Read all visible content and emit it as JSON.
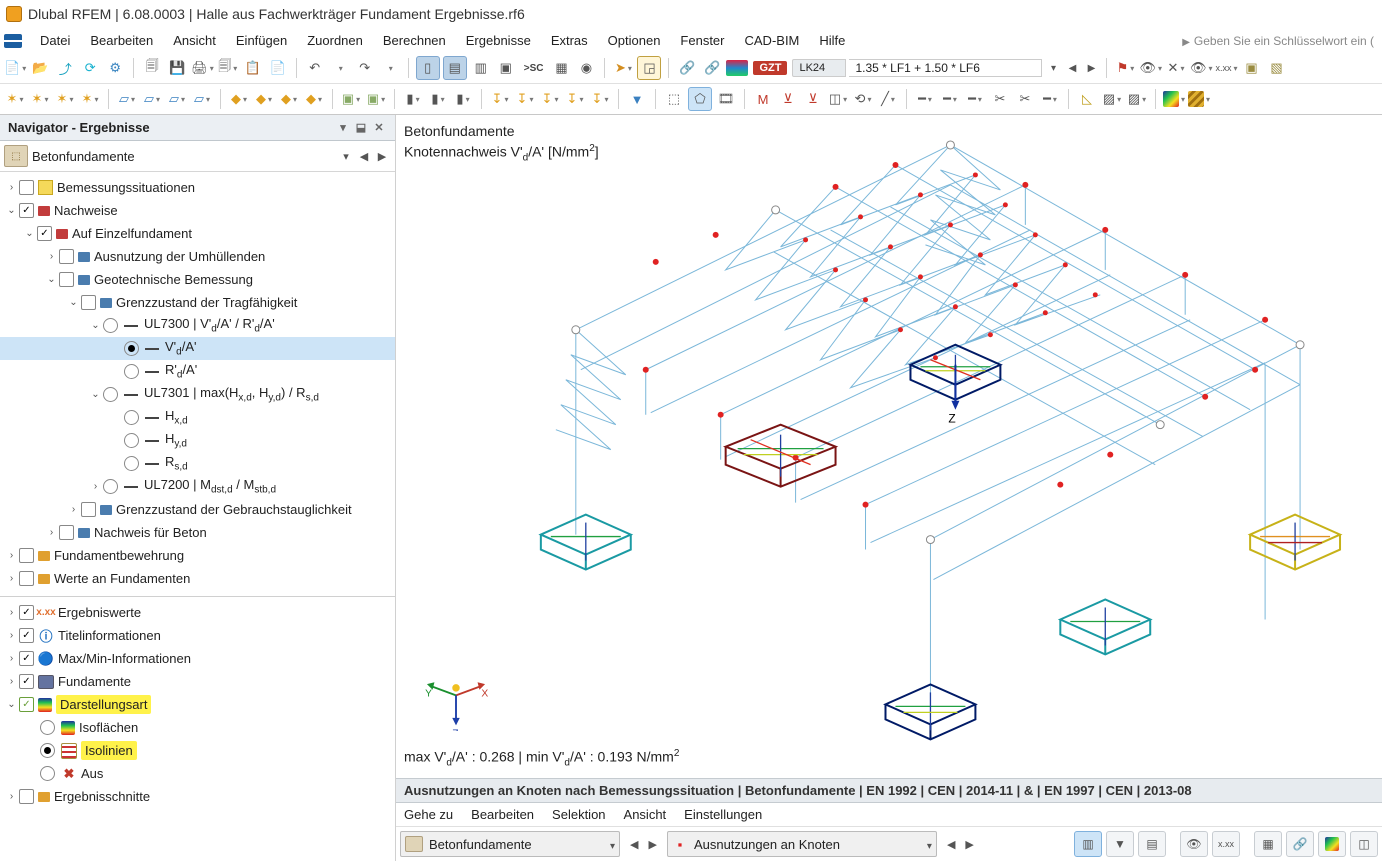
{
  "title": "Dlubal RFEM | 6.08.0003 | Halle aus Fachwerkträger Fundament Ergebnisse.rf6",
  "menu": {
    "items": [
      "Datei",
      "Bearbeiten",
      "Ansicht",
      "Einfügen",
      "Zuordnen",
      "Berechnen",
      "Ergebnisse",
      "Extras",
      "Optionen",
      "Fenster",
      "CAD-BIM",
      "Hilfe"
    ],
    "keyhint": "Geben Sie ein Schlüsselwort ein ("
  },
  "combo": {
    "gzt": "GZT",
    "lk_label": "LK24",
    "lk_desc": "1.35 * LF1 + 1.50 * LF6"
  },
  "navigator": {
    "title": "Navigator - Ergebnisse",
    "selector": "Betonfundamente",
    "tree": {
      "bem_sit": "Bemessungssituationen",
      "nachweise": "Nachweise",
      "auf_einzel": "Auf Einzelfundament",
      "ausnutz": "Ausnutzung der Umhüllenden",
      "geotech": "Geotechnische Bemessung",
      "gzt_trag": "Grenzzustand der Tragfähigkeit",
      "ul7300": "UL7300 | V'd/A' / R'd/A'",
      "vda": "V'd/A'",
      "rda": "R'd/A'",
      "ul7301": "UL7301 | max(Hx,d, Hy,d) / Rs,d",
      "hxd": "Hx,d",
      "hyd": "Hy,d",
      "rsd": "Rs,d",
      "ul7200": "UL7200 | Mdst,d / Mstb,d",
      "gebrauch": "Grenzzustand der Gebrauchstauglichkeit",
      "nachweis_beton": "Nachweis für Beton",
      "fund_bew": "Fundamentbewehrung",
      "werte_fund": "Werte an Fundamenten",
      "erg_werte": "Ergebniswerte",
      "titel_info": "Titelinformationen",
      "maxmin": "Max/Min-Informationen",
      "fundamente": "Fundamente",
      "darst": "Darstellungsart",
      "iso_fl": "Isoflächen",
      "iso_ln": "Isolinien",
      "aus": "Aus",
      "erg_schnitte": "Ergebnisschnitte"
    }
  },
  "viewport": {
    "title1": "Betonfundamente",
    "title2_pre": "Knotennachweis V'",
    "title2_sub1": "d",
    "title2_mid": "/A' [N/mm",
    "title2_sup": "2",
    "title2_end": "]",
    "stat_max_lbl": "max V'",
    "stat_sub": "d",
    "stat_max_val": "/A' : 0.268",
    "stat_sep": " | ",
    "stat_min_lbl": "min V'",
    "stat_min_val": "/A' : 0.193 N/mm",
    "axis_x": "X",
    "axis_y": "Y",
    "axis_z": "Z"
  },
  "results": {
    "header": "Ausnutzungen an Knoten nach Bemessungssituation | Betonfundamente | EN 1992 | CEN | 2014-11 | & | EN 1997 | CEN | 2013-08",
    "menu": [
      "Gehe zu",
      "Bearbeiten",
      "Selektion",
      "Ansicht",
      "Einstellungen"
    ],
    "combo1": "Betonfundamente",
    "combo2": "Ausnutzungen an Knoten"
  }
}
